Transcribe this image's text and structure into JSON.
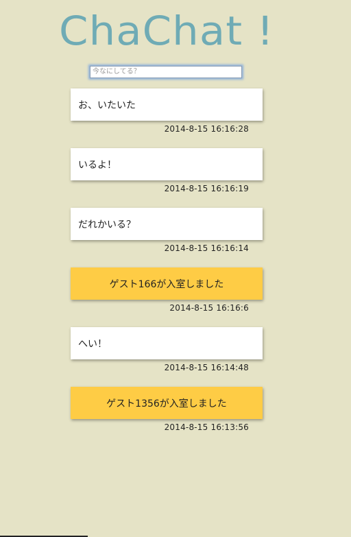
{
  "app": {
    "title": "ChaChat !"
  },
  "composer": {
    "placeholder": "今なにしてる？"
  },
  "messages": [
    {
      "text": "お、いたいた",
      "time": "2014-8-15 16:16:28",
      "kind": "user"
    },
    {
      "text": "いるよ！",
      "time": "2014-8-15 16:16:19",
      "kind": "user"
    },
    {
      "text": "だれかいる？",
      "time": "2014-8-15 16:16:14",
      "kind": "user"
    },
    {
      "text": "ゲスト166が入室しました",
      "time": "2014-8-15 16:16:6",
      "kind": "system"
    },
    {
      "text": "へい！",
      "time": "2014-8-15 16:14:48",
      "kind": "user"
    },
    {
      "text": "ゲスト1356が入室しました",
      "time": "2014-8-15 16:13:56",
      "kind": "system"
    }
  ],
  "colors": {
    "background": "#e5e3c6",
    "title": "#6fabb5",
    "system_bubble": "#fecc45",
    "user_bubble": "#ffffff"
  }
}
